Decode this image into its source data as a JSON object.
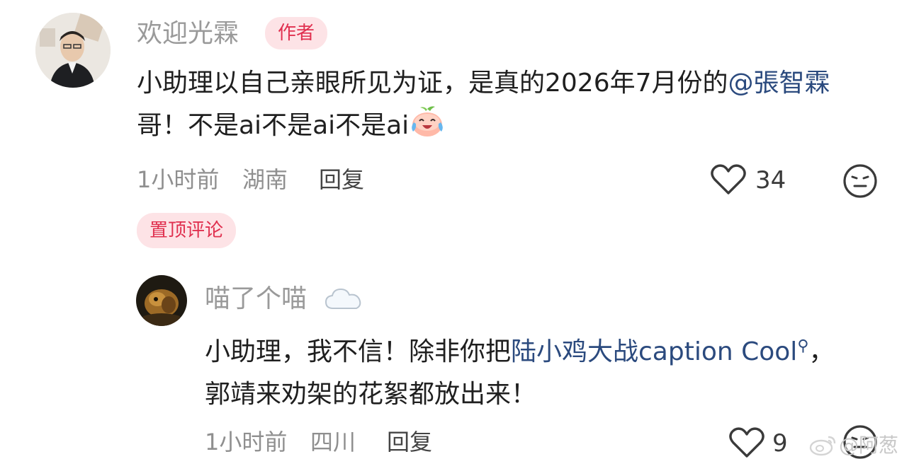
{
  "comments": [
    {
      "username": "欢迎光霖",
      "badge": "作者",
      "content_text": "小助理以自己亲眼所见为证，是真的2026年7月份的",
      "mention": "@張智霖",
      "content_after": "哥！不是ai不是ai不是ai",
      "inline_emoji": "crying-laughing-peach-emoji",
      "time": "1小时前",
      "location": "湖南",
      "reply_label": "回复",
      "like_count": "34"
    },
    {
      "pinned_label": "置顶评论",
      "username": "喵了个喵",
      "name_icon": "cloud-icon",
      "content_text": "小助理，我不信！除非你把",
      "topic": "陆小鸡大战caption Cool",
      "content_after": "，郭靖来劝架的花絮都放出来！",
      "time": "1小时前",
      "location": "四川",
      "reply_label": "回复",
      "like_count": "9"
    }
  ],
  "watermark": "@阿葱",
  "colors": {
    "accent_red": "#e0304f",
    "badge_bg": "#fde3e6",
    "link_blue": "#2b4a7e",
    "meta_gray": "#8f8f8f"
  }
}
